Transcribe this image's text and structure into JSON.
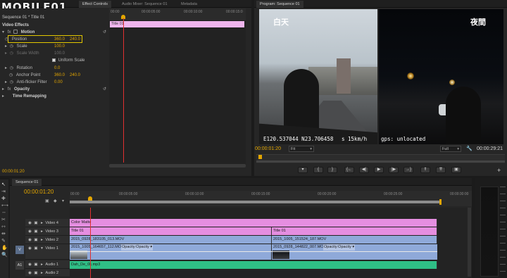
{
  "watermark": "MOBILE01",
  "effect_controls": {
    "tabs": [
      "Effect Controls",
      "Audio Mixer: Sequence 01",
      "Metadata"
    ],
    "clip_name": "Sequence 01 * Title 01",
    "section": "Video Effects",
    "motion": "Motion",
    "properties": [
      {
        "name": "Position",
        "v1": "360.0",
        "v2": "240.0"
      },
      {
        "name": "Scale",
        "v1": "100.0",
        "v2": ""
      },
      {
        "name": "Scale Width",
        "v1": "100.0",
        "v2": ""
      },
      {
        "name": "Rotation",
        "v1": "0.0",
        "v2": ""
      },
      {
        "name": "Anchor Point",
        "v1": "360.0",
        "v2": "240.0"
      },
      {
        "name": "Anti-flicker Filter",
        "v1": "0.00",
        "v2": ""
      }
    ],
    "uniform_scale": "Uniform Scale",
    "opacity": "Opacity",
    "time_remapping": "Time Remapping",
    "mini_ruler": [
      "00:00",
      "00:00:05:00",
      "00:00:10:00",
      "00:00:15:0"
    ],
    "mini_clip": "Title 01",
    "timecode": "00:00:01:20"
  },
  "program": {
    "tab": "Program: Sequence 01",
    "left_label": "白天",
    "right_label": "夜間",
    "hud_coords": "E120.537044 N23.706458",
    "hud_speed": "s  15km/h",
    "hud_gps": "gps: unlocated",
    "current_time": "00:00:01:20",
    "fit": "Fit",
    "quality": "Full",
    "duration": "00:00:29:21"
  },
  "timeline": {
    "tab": "Sequence 01",
    "timecode": "00:00:01:20",
    "ruler": [
      "00:00",
      "00:00:05:00",
      "00:00:10:00",
      "00:00:15:00",
      "00:00:20:00",
      "00:00:25:00",
      "00:00:30:00"
    ],
    "tracks": [
      {
        "label": "Video 4"
      },
      {
        "label": "Video 3"
      },
      {
        "label": "Video 2"
      },
      {
        "label": "Video 1"
      },
      {
        "label": "Audio 1"
      },
      {
        "label": "Audio 2"
      }
    ],
    "clips": {
      "v4": "Color Matte",
      "v3a": "Title 01",
      "v3b": "Title 01",
      "v2a": "2015_0928_183105_013.MOV",
      "v2b": "2015_1005_151524_187.MOV",
      "v1a": "2015_1005_164657_112.MOV",
      "v1a_fx": "Opacity:Opacity ▾",
      "v1b": "2015_0928_144822_007.MOV",
      "v1b_fx": "Opacity:Opacity ▾",
      "a1": "Dah_De_0k.mp3"
    },
    "track_tags": {
      "v": "V",
      "a": "A1"
    }
  },
  "colors": {
    "accent": "#e3a600",
    "playhead": "#e03030",
    "pink_clip": "#e58ee0",
    "blue_clip": "#8fa9d9",
    "green_clip": "#2fbf86",
    "highlight_box": "#e3c800"
  }
}
